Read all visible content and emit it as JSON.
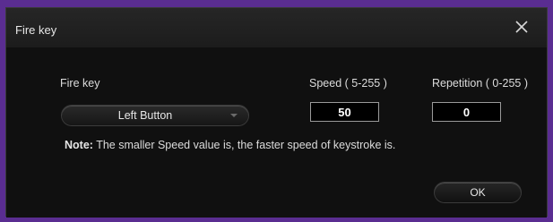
{
  "window": {
    "title": "Fire key"
  },
  "form": {
    "fire_key_label": "Fire key",
    "fire_key_value": "Left Button",
    "speed_label": "Speed ( 5-255 )",
    "speed_value": "50",
    "repetition_label": "Repetition ( 0-255 )",
    "repetition_value": "0"
  },
  "note": {
    "prefix": "Note:",
    "text": " The smaller Speed value is, the faster speed of keystroke is."
  },
  "buttons": {
    "ok_label": "OK"
  },
  "colors": {
    "frame_border": "#5a2d91",
    "dialog_bg": "#141414"
  },
  "icons": {
    "close": "close-icon",
    "dropdown": "chevron-down-icon"
  }
}
